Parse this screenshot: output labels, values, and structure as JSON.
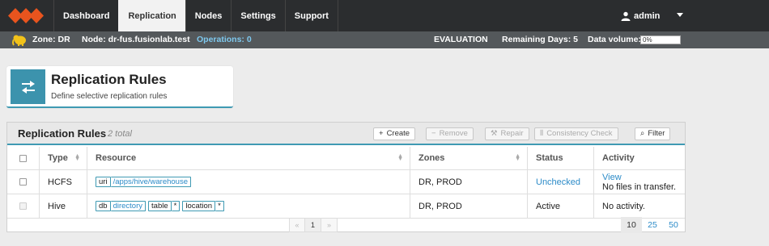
{
  "nav": {
    "tabs": [
      "Dashboard",
      "Replication",
      "Nodes",
      "Settings",
      "Support"
    ],
    "active_tab": "Replication",
    "user": "admin"
  },
  "status": {
    "zone": "Zone: DR",
    "node": "Node: dr-fus.fusionlab.test",
    "operations": "Operations: 0",
    "license": "EVALUATION",
    "remaining": "Remaining Days: 5",
    "volume_label": "Data volume:",
    "volume_value": "0%"
  },
  "header": {
    "title": "Replication Rules",
    "subtitle": "Define selective replication rules"
  },
  "panel": {
    "title": "Replication Rules",
    "count": "2 total",
    "buttons": {
      "create": "Create",
      "remove": "Remove",
      "repair": "Repair",
      "consistency": "Consistency Check",
      "filter": "Filter"
    }
  },
  "table": {
    "columns": [
      "Type",
      "Resource",
      "Zones",
      "Status",
      "Activity"
    ],
    "rows": [
      {
        "type": "HCFS",
        "resource": {
          "k1": "uri",
          "v1": "/apps/hive/warehouse"
        },
        "zones": "DR, PROD",
        "status": "Unchecked",
        "activity_link": "View",
        "activity_text": "No files in transfer."
      },
      {
        "type": "Hive",
        "resource": {
          "k1": "db",
          "v1": "directory",
          "k2": "table",
          "v2": "*",
          "k3": "location",
          "v3": "*"
        },
        "zones": "DR, PROD",
        "status": "Active",
        "activity_text": "No activity."
      }
    ]
  },
  "pager": {
    "prev": "«",
    "current": "1",
    "next": "»",
    "sizes": [
      "10",
      "25",
      "50"
    ]
  },
  "colors": {
    "accent": "#3f9ab3",
    "link": "#2c8bc8",
    "nav_bg": "#2b2d2f",
    "status_bg": "#54585b"
  }
}
